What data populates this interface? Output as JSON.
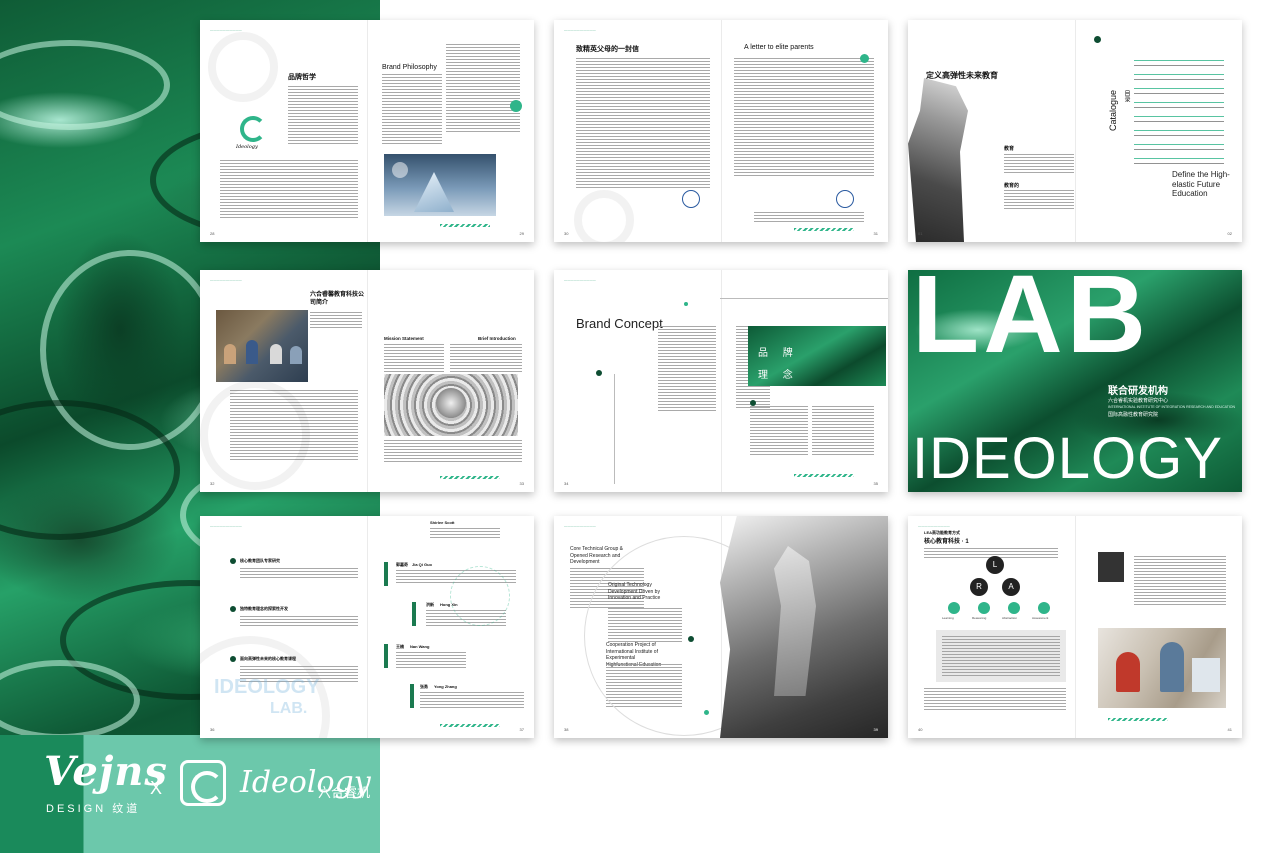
{
  "brand": {
    "vejns": "Vejns",
    "design": "DESIGN 纹道",
    "cross": "X",
    "ideology": "Ideology",
    "cn": "六合睿机"
  },
  "spread1": {
    "title_cn": "品牌哲学",
    "title_en": "Brand Philosophy",
    "logo_text": "Ideology"
  },
  "spread2": {
    "title_cn": "致精英父母的一封信",
    "title_en": "A letter to elite parents"
  },
  "spread3": {
    "title_cn": "定义高弹性未来教育",
    "catalogue": "Catalogue",
    "catalogue_cn": "目录",
    "define": "Define the High-elastic Future Education",
    "subtitle_cn": "教育",
    "subtitle2_cn": "教育的"
  },
  "spread4": {
    "title_cn": "六合睿馨教育科技公司简介",
    "mission": "Mission Statement",
    "brief": "Brief Introduction"
  },
  "spread5": {
    "title_en": "Brand Concept",
    "cn1": "品 牌",
    "cn2": "理 念"
  },
  "spread6": {
    "lab": "LAB",
    "ideology": "IDEOLOGY",
    "cn": "联合研发机构",
    "sub": "六合睿机实验教育研究中心",
    "sub2": "INTERNATIONAL INSTITUTE OF INTEGRATION RESEARCH AND EDUCATION",
    "sub3": "国际高融性教育研究院"
  },
  "spread7": {
    "items": [
      "核心教育团队专家研究",
      "独特教育理念的探索性开发",
      "面向高弹性未来的核心教育课程"
    ],
    "people": [
      "Shirlee Scott",
      "Jia Qi Guo",
      "Hong Xin",
      "Nan Wang",
      "Yong Zhang"
    ],
    "people_cn": [
      "",
      "郭嘉奇",
      "洪新",
      "王楠",
      "张勇"
    ],
    "wm_logo": "IDEOLOGY",
    "wm_lab": "LAB."
  },
  "spread8": {
    "title1": "Core Technical Group & Opened Research and Development",
    "title2": "Original Technology Development Driven by Innovation and Practice",
    "title3": "Cooperation Project of International Institute of Experimental Highfunctional Education"
  },
  "spread9": {
    "title_cn": "核心教育科技 · 1",
    "sub_cn": "LEA高功能教育方式",
    "badge_top": "L",
    "badge_left": "R",
    "badge_right": "A",
    "labels": [
      "Learning",
      "Reasoning",
      "Abstraction",
      "Assessment"
    ]
  },
  "colors": {
    "accent": "#2fb58a",
    "brand_dark": "#0e6e45",
    "brand_light": "#6cc8ab"
  }
}
